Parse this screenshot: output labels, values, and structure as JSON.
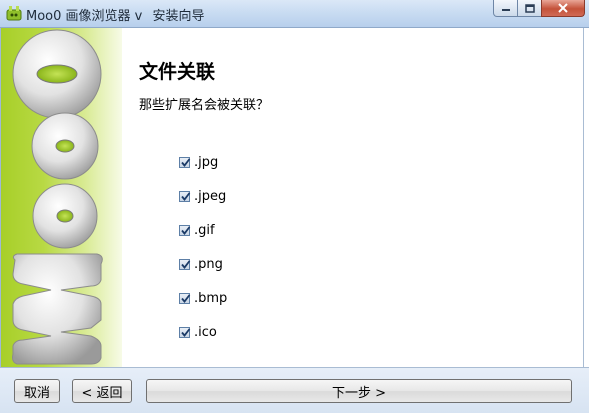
{
  "window": {
    "title_parts": [
      "Moo0 画像浏览器 v",
      "安装向导"
    ]
  },
  "banner": {
    "logo_text": "Moo0"
  },
  "page": {
    "heading": "文件关联",
    "question": "那些扩展名会被关联？"
  },
  "extensions": [
    {
      "label": ".jpg",
      "checked": true
    },
    {
      "label": ".jpeg",
      "checked": true
    },
    {
      "label": ".gif",
      "checked": true
    },
    {
      "label": ".png",
      "checked": true
    },
    {
      "label": ".bmp",
      "checked": true
    },
    {
      "label": ".ico",
      "checked": true
    }
  ],
  "buttons": {
    "cancel": "取消",
    "back": "< 返回",
    "next": "下一步 >"
  },
  "colors": {
    "banner_green": "#a7cf28",
    "close_red": "#c4523a"
  }
}
